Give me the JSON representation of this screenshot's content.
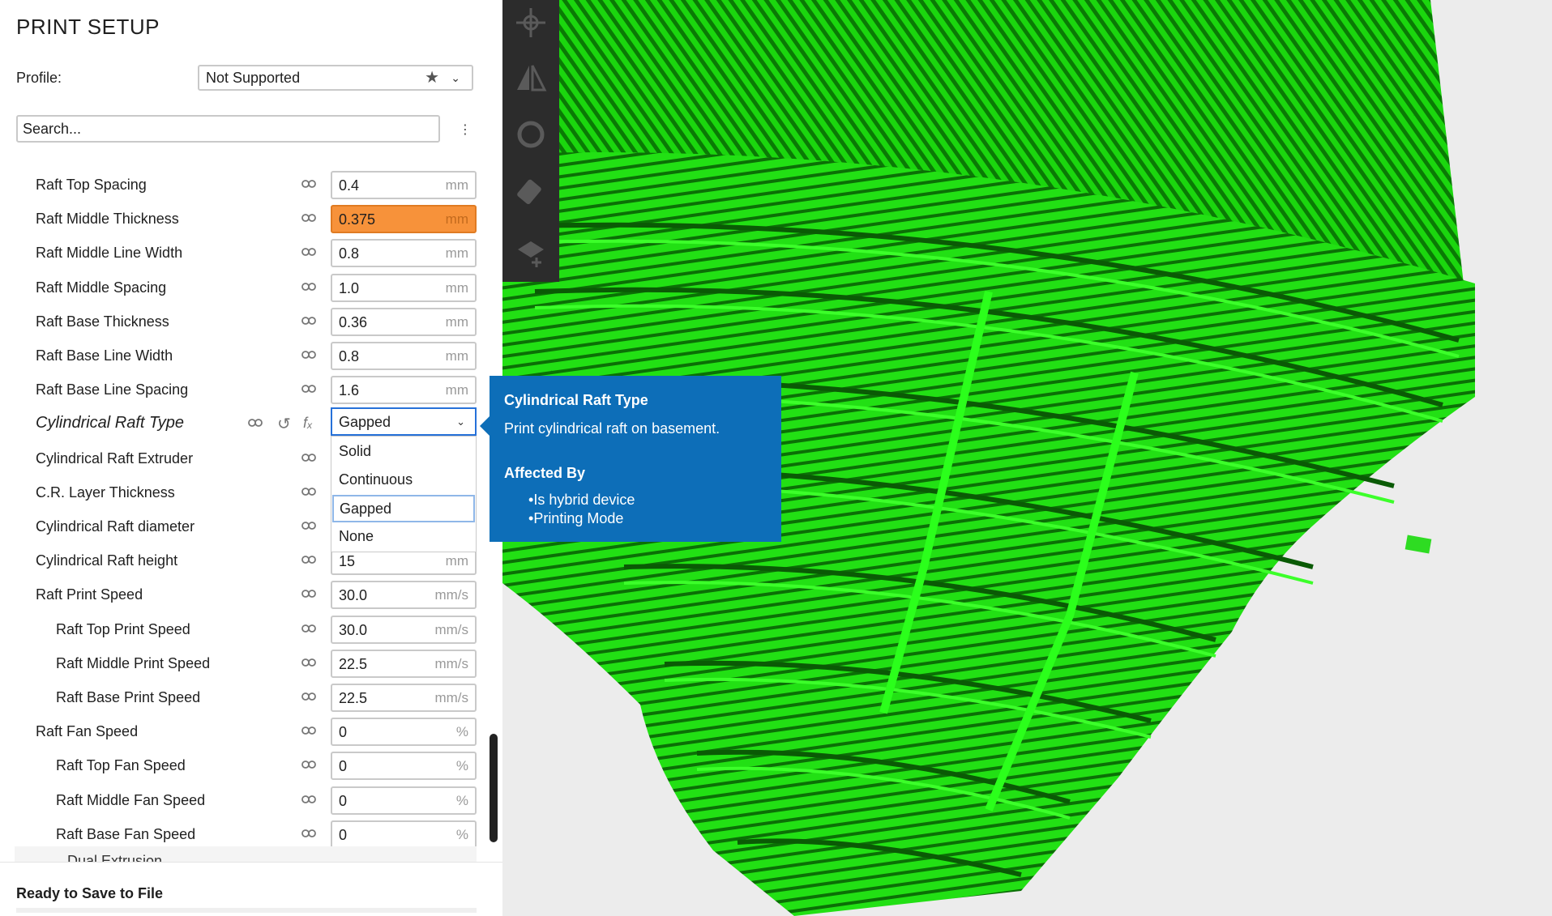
{
  "panel": {
    "title": "PRINT SETUP",
    "profile_label": "Profile:",
    "profile_value": "Not Supported",
    "search_placeholder": "Search...",
    "settings": [
      {
        "label": "Raft Top Spacing",
        "value": "0.4",
        "unit": "mm"
      },
      {
        "label": "Raft Middle Thickness",
        "value": "0.375",
        "unit": "mm",
        "warning": true
      },
      {
        "label": "Raft Middle Line Width",
        "value": "0.8",
        "unit": "mm"
      },
      {
        "label": "Raft Middle Spacing",
        "value": "1.0",
        "unit": "mm"
      },
      {
        "label": "Raft Base Thickness",
        "value": "0.36",
        "unit": "mm"
      },
      {
        "label": "Raft Base Line Width",
        "value": "0.8",
        "unit": "mm"
      },
      {
        "label": "Raft Base Line Spacing",
        "value": "1.6",
        "unit": "mm"
      },
      {
        "label": "Cylindrical Raft Type",
        "value": "Gapped",
        "options": [
          "Solid",
          "Continuous",
          "Gapped",
          "None"
        ]
      },
      {
        "label": "Cylindrical Raft Extruder"
      },
      {
        "label": "C.R. Layer Thickness"
      },
      {
        "label": "Cylindrical Raft diameter"
      },
      {
        "label": "Cylindrical Raft height",
        "value": "15",
        "unit": "mm"
      },
      {
        "label": "Raft Print Speed",
        "value": "30.0",
        "unit": "mm/s"
      },
      {
        "label": "Raft Top Print Speed",
        "value": "30.0",
        "unit": "mm/s"
      },
      {
        "label": "Raft Middle Print Speed",
        "value": "22.5",
        "unit": "mm/s"
      },
      {
        "label": "Raft Base Print Speed",
        "value": "22.5",
        "unit": "mm/s"
      },
      {
        "label": "Raft Fan Speed",
        "value": "0",
        "unit": "%"
      },
      {
        "label": "Raft Top Fan Speed",
        "value": "0",
        "unit": "%"
      },
      {
        "label": "Raft Middle Fan Speed",
        "value": "0",
        "unit": "%"
      },
      {
        "label": "Raft Base Fan Speed",
        "value": "0",
        "unit": "%"
      }
    ],
    "next_section": "Dual Extrusion",
    "footer_status": "Ready to Save to File"
  },
  "tooltip": {
    "title": "Cylindrical Raft Type",
    "description": "Print cylindrical raft on basement.",
    "affected_by_label": "Affected By",
    "affected_by": [
      "Is hybrid device",
      "Printing Mode"
    ]
  },
  "toolbar": [
    "move-tool-icon",
    "mirror-tool-icon",
    "rotate-tool-icon",
    "eraser-tool-icon",
    "support-blocker-icon"
  ],
  "colors": {
    "accent": "#0d6eb8",
    "warning": "#f7923a",
    "model": "#22e014",
    "toolbar": "#2c2c2c"
  }
}
